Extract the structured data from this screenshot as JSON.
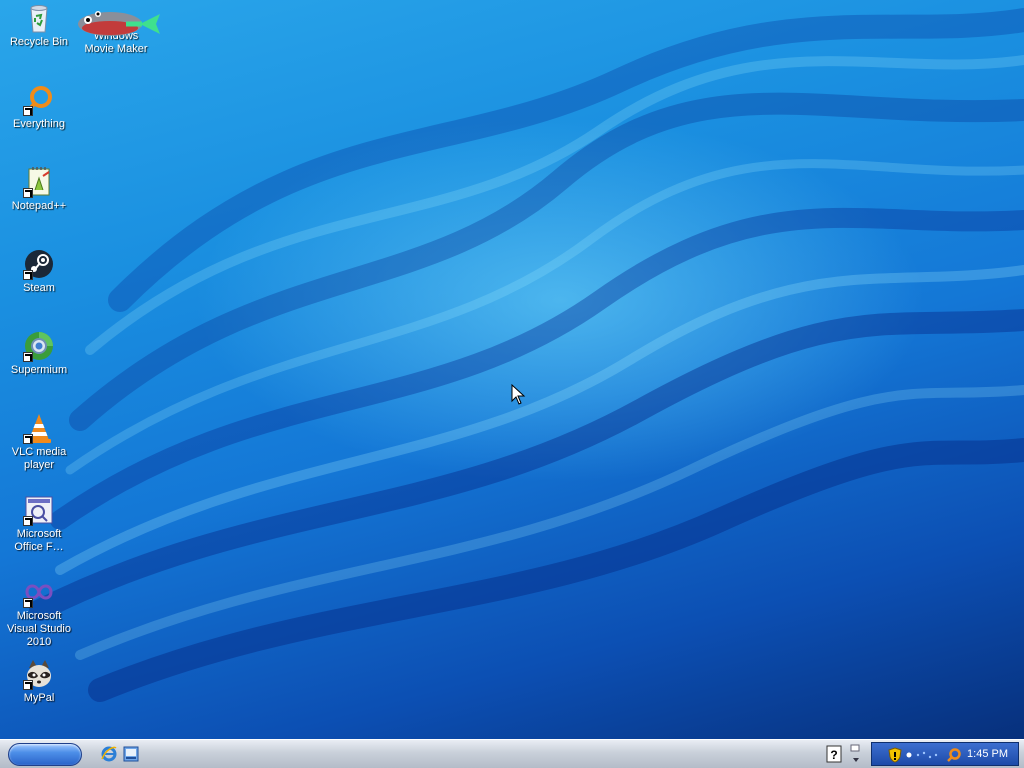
{
  "desktop": {
    "icons": [
      {
        "label": "Recycle Bin",
        "icon": "recycle-bin-icon"
      },
      {
        "label": "Windows Movie Maker",
        "icon": "movie-maker-fish-icon"
      },
      {
        "label": "Everything",
        "icon": "everything-search-icon"
      },
      {
        "label": "Notepad++",
        "icon": "notepad-plus-plus-icon"
      },
      {
        "label": "Steam",
        "icon": "steam-icon"
      },
      {
        "label": "Supermium",
        "icon": "supermium-icon"
      },
      {
        "label": "VLC media player",
        "icon": "vlc-cone-icon"
      },
      {
        "label": "Microsoft Office F…",
        "icon": "office-icon"
      },
      {
        "label": "Microsoft Visual Studio 2010",
        "icon": "visual-studio-icon"
      },
      {
        "label": "MyPal",
        "icon": "mypal-raccoon-icon"
      }
    ]
  },
  "taskbar": {
    "start_icon": "start-button",
    "quick_launch": [
      {
        "icon": "internet-explorer-icon"
      },
      {
        "icon": "show-desktop-icon"
      }
    ],
    "tray": {
      "help_icon": "help-icon",
      "collapse_icon": "collapse-arrows-icon",
      "notify_icons": [
        "security-shield-icon",
        "network-dots-icon",
        "everything-search-icon"
      ],
      "clock": "1:45 PM"
    }
  },
  "colors": {
    "wallpaper_top": "#2aa6ea",
    "wallpaper_bottom": "#07307c",
    "taskbar": "#c9d0da",
    "tray": "#1d4aa8"
  }
}
